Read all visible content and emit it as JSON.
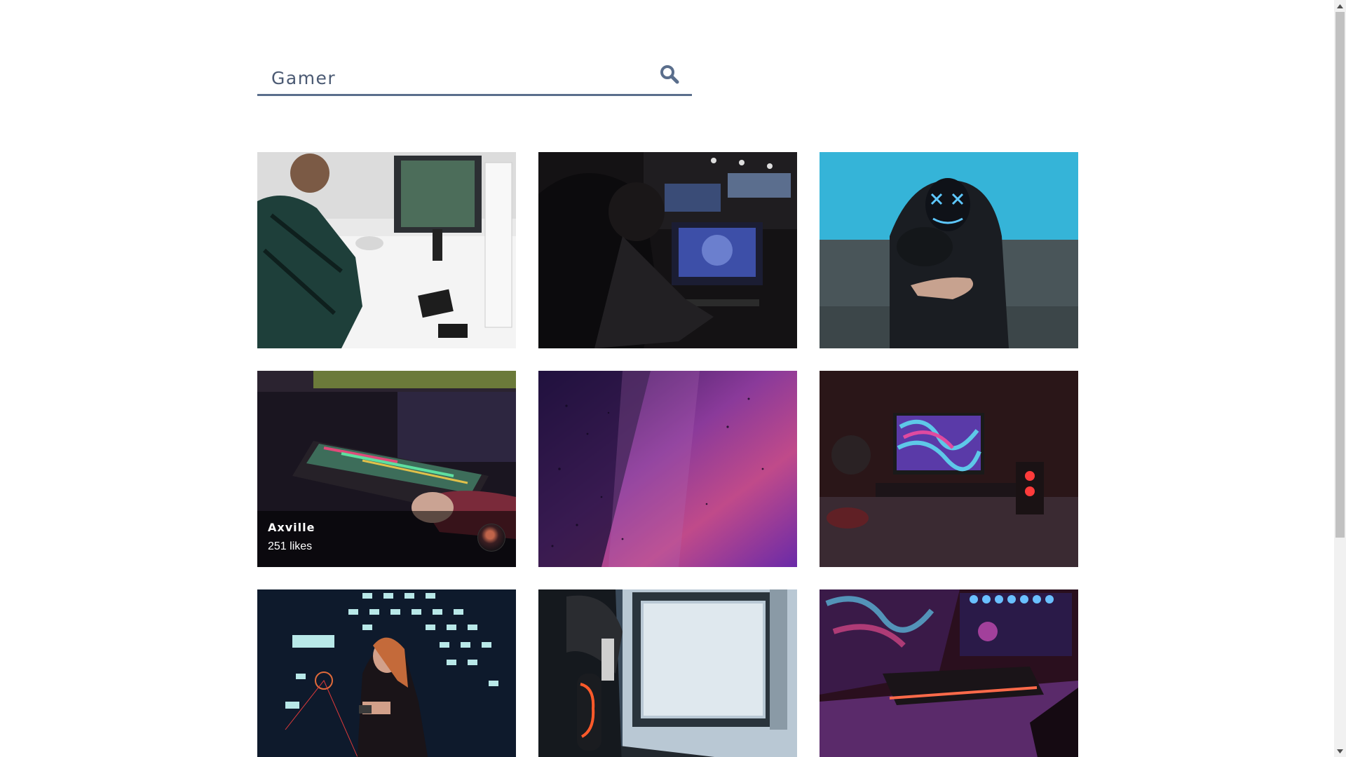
{
  "search": {
    "value": "Gamer",
    "icon": "search-icon",
    "accent": "#5a6e8c"
  },
  "gallery": {
    "cards": [
      {
        "name": "photo-man-playing-controller"
      },
      {
        "name": "photo-esports-player"
      },
      {
        "name": "photo-neon-mask-controller"
      },
      {
        "name": "photo-rgb-keyboard",
        "author": "Axville",
        "likes": "251 likes",
        "hover": true
      },
      {
        "name": "photo-purple-galaxy"
      },
      {
        "name": "photo-red-desk-setup"
      },
      {
        "name": "photo-space-invaders-girl"
      },
      {
        "name": "photo-headphones-monitor"
      },
      {
        "name": "photo-purple-keyboard"
      }
    ]
  }
}
